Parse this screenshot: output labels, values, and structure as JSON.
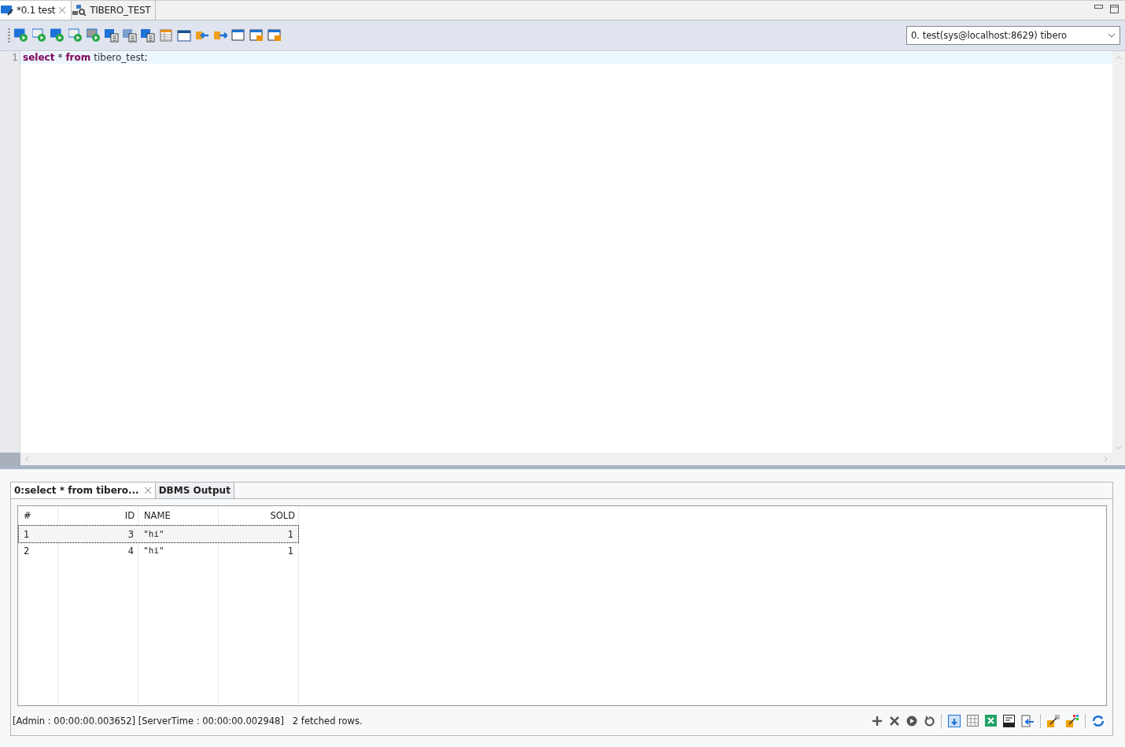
{
  "editor_tabs": [
    {
      "label": "*0.1 test",
      "selected": true,
      "closable": true
    },
    {
      "label": "TIBERO_TEST",
      "selected": false,
      "closable": false
    }
  ],
  "connection": {
    "value": "0. test(sys@localhost:8629) tibero"
  },
  "editor": {
    "lines": [
      {
        "number": "1",
        "tokens": [
          {
            "text": "select",
            "kind": "keyword"
          },
          {
            "text": "*",
            "kind": "plain"
          },
          {
            "text": "from",
            "kind": "keyword"
          },
          {
            "text": "tibero_test;",
            "kind": "plain"
          }
        ]
      }
    ]
  },
  "result_tabs": [
    {
      "label": "0:select * from tibero...",
      "selected": true,
      "closable": true
    },
    {
      "label": "DBMS Output",
      "selected": false,
      "closable": false
    }
  ],
  "table": {
    "columns": [
      {
        "label": "#"
      },
      {
        "label": "ID"
      },
      {
        "label": "NAME"
      },
      {
        "label": "SOLD"
      }
    ],
    "rows": [
      {
        "selected": true,
        "cells": [
          "1",
          "3",
          "\"hi\"",
          "1"
        ]
      },
      {
        "selected": false,
        "cells": [
          "2",
          "4",
          "\"hi\"",
          "1"
        ]
      }
    ]
  },
  "status": "[Admin : 00:00:00.003652] [ServerTime : 00:00:00.002948]   2 fetched rows."
}
